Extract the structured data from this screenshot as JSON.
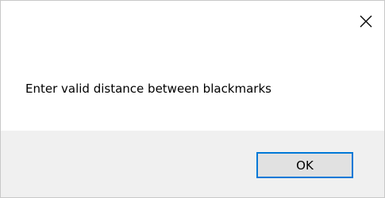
{
  "dialog": {
    "message": "Enter valid distance between blackmarks",
    "ok_label": "OK",
    "close_icon": "close-icon"
  },
  "colors": {
    "accent": "#0078d7",
    "footer_bg": "#f0f0f0",
    "button_bg": "#e1e1e1"
  }
}
